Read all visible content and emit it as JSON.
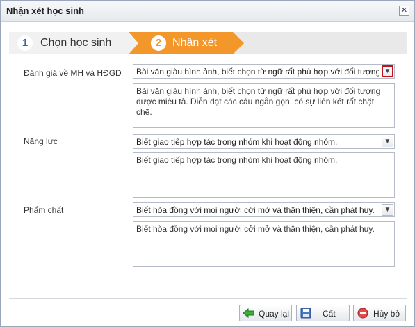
{
  "dialog": {
    "title": "Nhận xét học sinh",
    "close_glyph": "✕"
  },
  "steps": [
    {
      "number": "1",
      "label": "Chọn học sinh"
    },
    {
      "number": "2",
      "label": "Nhận xét"
    }
  ],
  "form": {
    "mh_hdgd": {
      "label": "Đánh giá về MH và HĐGD",
      "selected": "Bài văn giàu hình ảnh, biết chọn từ ngữ rất phù hợp với đối tượng",
      "comment": "Bài văn giàu hình ảnh, biết chọn từ ngữ rất phù hợp với đối tượng được miêu tả. Diễn đạt các câu ngắn gọn, có sự liên kết rất chặt chẽ."
    },
    "nang_luc": {
      "label": "Năng lực",
      "selected": "Biết giao tiếp hợp tác trong nhóm khi hoạt động nhóm.",
      "comment": "Biết giao tiếp hợp tác trong nhóm khi hoạt động nhóm."
    },
    "pham_chat": {
      "label": "Phẩm chất",
      "selected": "Biết hòa đồng với mọi người cởi mở và thân thiện, cần phát huy.",
      "comment": "Biết hòa đồng với mọi người cởi mở và thân thiện, cần phát huy."
    }
  },
  "buttons": {
    "back": "Quay lại",
    "save": "Cất",
    "cancel": "Hủy bỏ"
  },
  "icons": {
    "back": "arrow-left-icon",
    "save": "floppy-disk-icon",
    "cancel": "cancel-icon"
  },
  "colors": {
    "step_active": "#f3972b",
    "step_number": "#2b6aa8",
    "highlight": "#c0121d"
  }
}
